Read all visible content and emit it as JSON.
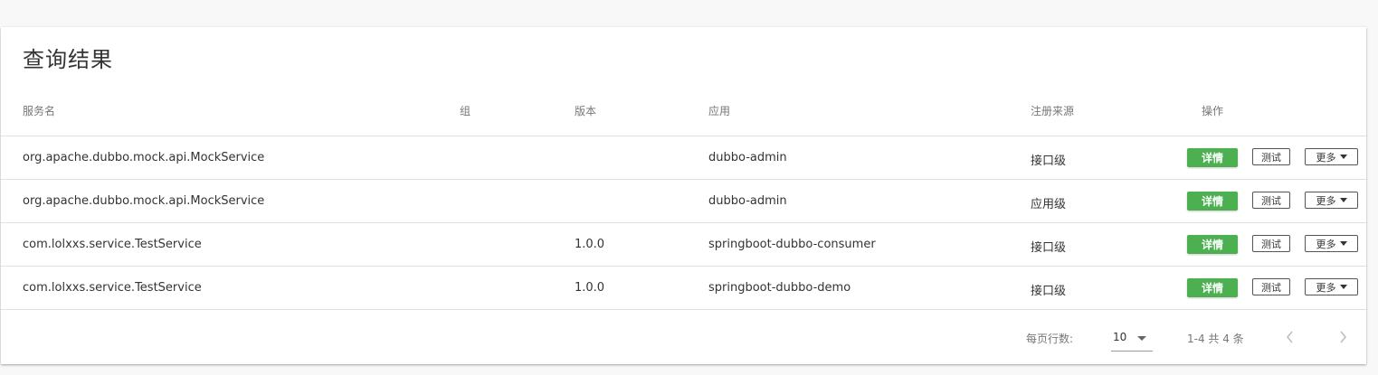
{
  "card": {
    "title": "查询结果"
  },
  "table": {
    "headers": {
      "service": "服务名",
      "group": "组",
      "version": "版本",
      "app": "应用",
      "source": "注册来源",
      "actions": "操作"
    },
    "rows": [
      {
        "service": "org.apache.dubbo.mock.api.MockService",
        "group": "",
        "version": "",
        "app": "dubbo-admin",
        "source": "接口级"
      },
      {
        "service": "org.apache.dubbo.mock.api.MockService",
        "group": "",
        "version": "",
        "app": "dubbo-admin",
        "source": "应用级"
      },
      {
        "service": "com.lolxxs.service.TestService",
        "group": "",
        "version": "1.0.0",
        "app": "springboot-dubbo-consumer",
        "source": "接口级"
      },
      {
        "service": "com.lolxxs.service.TestService",
        "group": "",
        "version": "1.0.0",
        "app": "springboot-dubbo-demo",
        "source": "接口级"
      }
    ],
    "actions": {
      "detail": "详情",
      "test": "测试",
      "more": "更多"
    }
  },
  "pagination": {
    "rows_per_page_label": "每页行数:",
    "rows_per_page_value": "10",
    "range_text": "1-4 共 4 条"
  },
  "icons": {
    "more_dropdown": "caret-down-icon",
    "rows_per_page": "caret-down-icon",
    "prev": "chevron-left-icon",
    "next": "chevron-right-icon"
  },
  "colors": {
    "detail_button": "#4caf50",
    "background": "#f8f8f8",
    "card": "#ffffff"
  }
}
